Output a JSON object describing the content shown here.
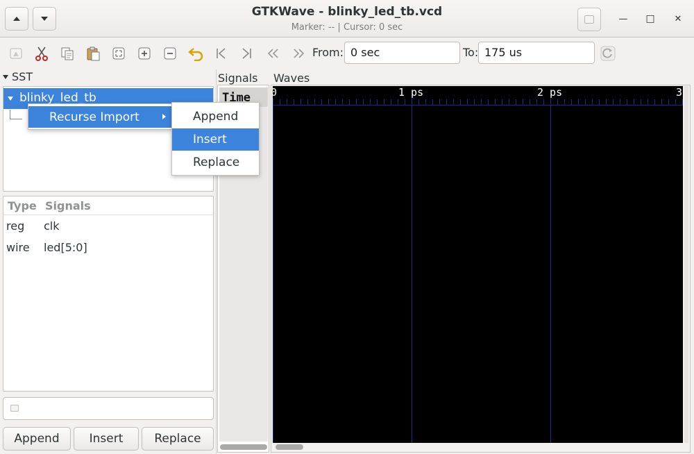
{
  "window": {
    "title": "GTKWave - blinky_led_tb.vcd",
    "subtitle": "Marker: --  |  Cursor: 0 sec",
    "minimize_glyph": "—",
    "maximize_glyph": "□",
    "close_glyph": "✕"
  },
  "toolbar": {
    "icons": [
      "show-icon",
      "cut-icon",
      "copy-icon",
      "paste-icon",
      "zoom-fit-icon",
      "zoom-in-icon",
      "zoom-out-icon",
      "undo-icon",
      "go-first-icon",
      "go-last-icon",
      "back-icon",
      "forward-icon"
    ],
    "from_label": "From:",
    "from_value": "0 sec",
    "to_label": "To:",
    "to_value": "175 us"
  },
  "sst": {
    "label": "SST",
    "tree_root": "blinky_led_tb",
    "columns": [
      "Type",
      "Signals"
    ],
    "rows": [
      {
        "type": "reg",
        "signal": "clk"
      },
      {
        "type": "wire",
        "signal": "led[5:0]"
      }
    ],
    "buttons": {
      "append": "Append",
      "insert": "Insert",
      "replace": "Replace"
    }
  },
  "signals_pane": {
    "label": "Signals",
    "time_label": "Time"
  },
  "waves_pane": {
    "label": "Waves",
    "ticks": [
      "0",
      "1 ps",
      "2 ps",
      "3"
    ],
    "colors": {
      "background": "#000000",
      "grid": "#1e2a8a",
      "text": "#ffffff"
    }
  },
  "context_menu": {
    "item": "Recurse Import",
    "submenu": [
      "Append",
      "Insert",
      "Replace"
    ],
    "active_item": "Insert"
  },
  "colors": {
    "accent": "#3c83dc"
  }
}
